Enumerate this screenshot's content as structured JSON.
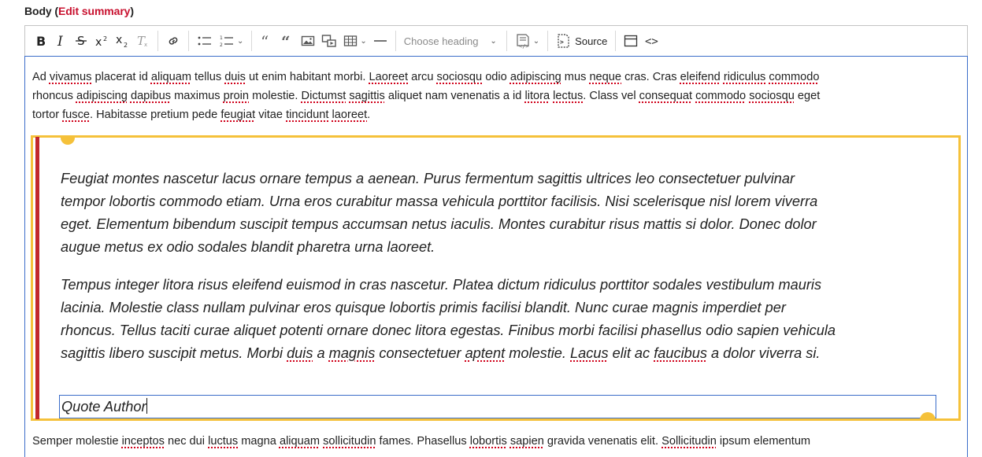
{
  "field": {
    "label": "Body",
    "open_paren": "(",
    "edit_summary": "Edit summary",
    "close_paren": ")"
  },
  "toolbar": {
    "buttons": {
      "bold": "bold-icon",
      "italic": "italic-icon",
      "strikethrough": "strikethrough-icon",
      "superscript": "superscript-icon",
      "subscript": "subscript-icon",
      "remove_format": "remove-format-icon",
      "link": "link-icon",
      "bulleted_list": "bulleted-list-icon",
      "numbered_list": "numbered-list-icon",
      "blockquote": "blockquote-icon",
      "pull_quote": "pull-quote-icon",
      "image": "image-icon",
      "media": "media-icon",
      "table": "table-icon",
      "horizontal_line": "horizontal-line-icon",
      "code_block": "code-block-icon",
      "source": "source-icon",
      "template": "template-icon",
      "show_blocks": "code-icon"
    },
    "heading_placeholder": "Choose heading",
    "source_label": "Source"
  },
  "content": {
    "p1": [
      [
        "Ad ",
        false
      ],
      [
        "vivamus",
        true
      ],
      [
        " placerat id ",
        false
      ],
      [
        "aliquam",
        true
      ],
      [
        " tellus ",
        false
      ],
      [
        "duis",
        true
      ],
      [
        " ut enim habitant morbi. ",
        false
      ],
      [
        "Laoreet",
        true
      ],
      [
        " arcu ",
        false
      ],
      [
        "sociosqu",
        true
      ],
      [
        " odio ",
        false
      ],
      [
        "adipiscing",
        true
      ],
      [
        " mus ",
        false
      ],
      [
        "neque",
        true
      ],
      [
        " cras. Cras ",
        false
      ],
      [
        "eleifend",
        true
      ],
      [
        " ",
        false
      ],
      [
        "ridiculus",
        true
      ],
      [
        " ",
        false
      ],
      [
        "commodo",
        true
      ]
    ],
    "p2": [
      [
        "rhoncus ",
        false
      ],
      [
        "adipiscing",
        true
      ],
      [
        " ",
        false
      ],
      [
        "dapibus",
        true
      ],
      [
        " maximus ",
        false
      ],
      [
        "proin",
        true
      ],
      [
        " molestie. ",
        false
      ],
      [
        "Dictumst",
        true
      ],
      [
        " ",
        false
      ],
      [
        "sagittis",
        true
      ],
      [
        " aliquet nam venenatis a id ",
        false
      ],
      [
        "litora",
        true
      ],
      [
        " ",
        false
      ],
      [
        "lectus",
        true
      ],
      [
        ". Class vel ",
        false
      ],
      [
        "consequat",
        true
      ],
      [
        " ",
        false
      ],
      [
        "commodo",
        true
      ],
      [
        " ",
        false
      ],
      [
        "sociosqu",
        true
      ],
      [
        " eget",
        false
      ]
    ],
    "p3": [
      [
        "tortor ",
        false
      ],
      [
        "fusce",
        true
      ],
      [
        ". Habitasse pretium pede ",
        false
      ],
      [
        "feugiat",
        true
      ],
      [
        " vitae ",
        false
      ],
      [
        "tincidunt",
        true
      ],
      [
        " ",
        false
      ],
      [
        "laoreet",
        true
      ],
      [
        ".",
        false
      ]
    ],
    "quote_lines": [
      [
        [
          "Feugiat montes nascetur lacus ornare tempus a aenean. Purus fermentum sagittis ultrices leo consectetuer pulvinar",
          false
        ]
      ],
      [
        [
          "tempor lobortis commodo etiam. Urna eros curabitur massa vehicula porttitor facilisis. Nisi scelerisque nisl lorem viverra",
          false
        ]
      ],
      [
        [
          "eget. Elementum bibendum suscipit tempus accumsan netus iaculis. Montes curabitur risus mattis si dolor. Donec dolor",
          false
        ]
      ],
      [
        [
          "augue metus ex odio sodales blandit pharetra urna laoreet.",
          false
        ]
      ],
      [
        [
          "Tempus integer litora risus eleifend euismod in cras nascetur. Platea dictum ridiculus porttitor sodales vestibulum mauris",
          false
        ]
      ],
      [
        [
          "lacinia. Molestie class nullam pulvinar eros quisque lobortis primis facilisi blandit. Nunc curae magnis imperdiet per",
          false
        ]
      ],
      [
        [
          "rhoncus. Tellus taciti curae aliquet potenti ornare donec litora egestas. Finibus morbi facilisi phasellus odio sapien vehicula",
          false
        ]
      ],
      [
        [
          "sagittis libero suscipit metus. Morbi ",
          false
        ],
        [
          "duis",
          true
        ],
        [
          " a ",
          false
        ],
        [
          "magnis",
          true
        ],
        [
          " consectetuer ",
          false
        ],
        [
          "aptent",
          true
        ],
        [
          " molestie. ",
          false
        ],
        [
          "Lacus",
          true
        ],
        [
          " elit ac ",
          false
        ],
        [
          "faucibus",
          true
        ],
        [
          " a dolor viverra si.",
          false
        ]
      ]
    ],
    "quote_author": "Quote Author",
    "p4": [
      [
        "Semper molestie ",
        false
      ],
      [
        "inceptos",
        true
      ],
      [
        " nec dui ",
        false
      ],
      [
        "luctus",
        true
      ],
      [
        " magna ",
        false
      ],
      [
        "aliquam",
        true
      ],
      [
        " ",
        false
      ],
      [
        "sollicitudin",
        true
      ],
      [
        " fames. Phasellus ",
        false
      ],
      [
        "lobortis",
        true
      ],
      [
        " ",
        false
      ],
      [
        "sapien",
        true
      ],
      [
        " gravida venenatis elit. ",
        false
      ],
      [
        "Sollicitudin",
        true
      ],
      [
        " ipsum elementum",
        false
      ]
    ]
  },
  "colors": {
    "accent_red": "#c8102e",
    "widget_yellow": "#f5c13a",
    "quote_bar": "#c1272d",
    "focus_blue": "#3b6dc9"
  }
}
